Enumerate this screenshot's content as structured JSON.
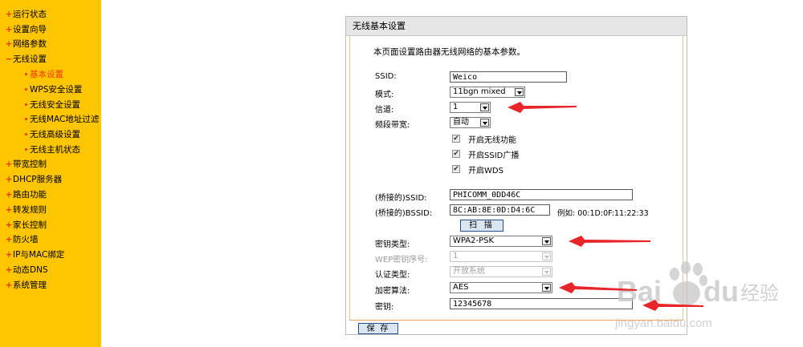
{
  "sidebar": {
    "items": [
      {
        "label": "运行状态",
        "bullet": "+"
      },
      {
        "label": "设置向导",
        "bullet": "+"
      },
      {
        "label": "网络参数",
        "bullet": "+"
      },
      {
        "label": "无线设置",
        "bullet": "−"
      },
      {
        "label": "基本设置",
        "bullet": "•",
        "active": true
      },
      {
        "label": "WPS安全设置",
        "bullet": "•"
      },
      {
        "label": "无线安全设置",
        "bullet": "•"
      },
      {
        "label": "无线MAC地址过滤",
        "bullet": "•"
      },
      {
        "label": "无线高级设置",
        "bullet": "•"
      },
      {
        "label": "无线主机状态",
        "bullet": "•"
      },
      {
        "label": "带宽控制",
        "bullet": "+"
      },
      {
        "label": "DHCP服务器",
        "bullet": "+"
      },
      {
        "label": "路由功能",
        "bullet": "+"
      },
      {
        "label": "转发规则",
        "bullet": "+"
      },
      {
        "label": "家长控制",
        "bullet": "+"
      },
      {
        "label": "防火墙",
        "bullet": "+"
      },
      {
        "label": "IP与MAC绑定",
        "bullet": "+"
      },
      {
        "label": "动态DNS",
        "bullet": "+"
      },
      {
        "label": "系统管理",
        "bullet": "+"
      }
    ]
  },
  "panel": {
    "title": "无线基本设置",
    "description": "本页面设置路由器无线网络的基本参数。"
  },
  "form": {
    "ssid": {
      "label": "SSID:",
      "value": "Weico"
    },
    "mode": {
      "label": "模式:",
      "value": "11bgn mixed"
    },
    "channel": {
      "label": "信道:",
      "value": "1"
    },
    "bandwidth": {
      "label": "频段带宽:",
      "value": "自动"
    },
    "checkboxes": [
      {
        "label": "开启无线功能",
        "checked": true
      },
      {
        "label": "开启SSID广播",
        "checked": true
      },
      {
        "label": "开启WDS",
        "checked": true
      }
    ],
    "bridged_ssid": {
      "label": "(桥接的)SSID:",
      "value": "PHICOMM_0DD46C"
    },
    "bridged_bssid": {
      "label": "(桥接的)BSSID:",
      "value": "8C:AB:8E:0D:D4:6C",
      "example": "例如: 00:1D:0F:11:22:33"
    },
    "scan_button": "扫 描",
    "key_type": {
      "label": "密钥类型:",
      "value": "WPA2-PSK"
    },
    "wep_index": {
      "label": "WEP密钥序号:",
      "value": "1"
    },
    "auth_type": {
      "label": "认证类型:",
      "value": "开放系统"
    },
    "encryption": {
      "label": "加密算法:",
      "value": "AES"
    },
    "key": {
      "label": "密钥:",
      "value": "12345678"
    }
  },
  "footer": {
    "save_label": "保 存"
  },
  "watermark": {
    "brand_a": "Bai",
    "brand_b": "du",
    "suffix": "经验",
    "url": "jingyan.baidu.com"
  },
  "colors": {
    "sidebar_bg": "#fdc601",
    "arrow": "#e8262a",
    "accent_bullet": "#e03a00"
  }
}
